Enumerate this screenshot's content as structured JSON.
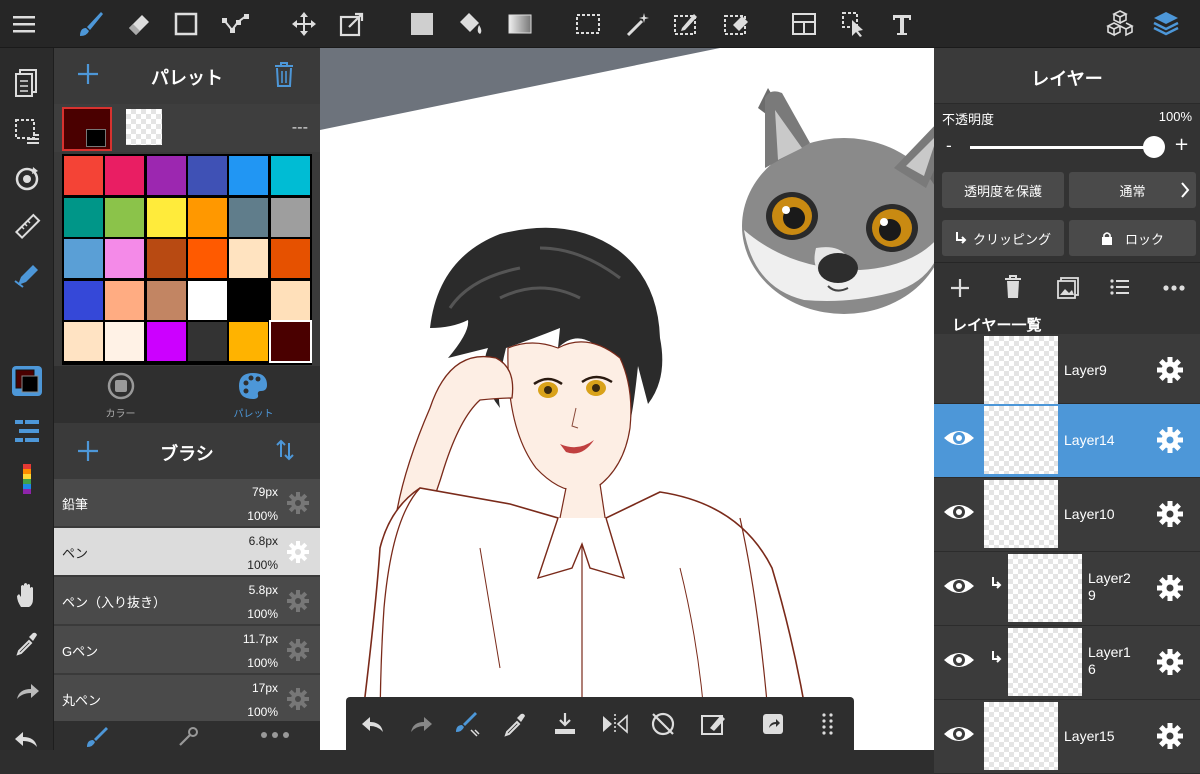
{
  "palette": {
    "title": "パレット",
    "right_text": "---",
    "current_color": "#4a0000",
    "tab_color_label": "カラー",
    "tab_palette_label": "パレット",
    "colors": [
      "#f44336",
      "#e91e63",
      "#9c27b0",
      "#3f51b5",
      "#2196f3",
      "#00bcd4",
      "#009688",
      "#8bc34a",
      "#ffeb3b",
      "#ff9800",
      "#607d8b",
      "#9e9e9e",
      "#5a9fd6",
      "#f48ae8",
      "#b84a12",
      "#ff5a00",
      "#ffe3c0",
      "#e65100",
      "#3548d8",
      "#ffac82",
      "#c28563",
      "#ffffff",
      "#000000",
      "#ffe0ba",
      "#ffe3c3",
      "#fff2e6",
      "#cc00ff",
      "#333333",
      "#ffb300",
      "#4a0000"
    ]
  },
  "brush": {
    "title": "ブラシ",
    "items": [
      {
        "name": "鉛筆",
        "size": "79px",
        "opacity": "100%"
      },
      {
        "name": "ペン",
        "size": "6.8px",
        "opacity": "100%"
      },
      {
        "name": "ペン（入り抜き）",
        "size": "5.8px",
        "opacity": "100%"
      },
      {
        "name": "Gペン",
        "size": "11.7px",
        "opacity": "100%"
      },
      {
        "name": "丸ペン",
        "size": "17px",
        "opacity": "100%"
      }
    ]
  },
  "layers": {
    "title": "レイヤー",
    "opacity_label": "不透明度",
    "opacity_value": "100%",
    "opacity_level": 1.0,
    "minus": "-",
    "plus": "+",
    "protect_label": "透明度を保護",
    "blend_label": "通常",
    "clipping_label": "クリッピング",
    "lock_label": "ロック",
    "list_title": "レイヤー一覧",
    "items": [
      {
        "name": "Layer9",
        "visible": false,
        "clipped": false
      },
      {
        "name": "Layer14",
        "visible": true,
        "clipped": false
      },
      {
        "name": "Layer10",
        "visible": true,
        "clipped": false
      },
      {
        "name": "Layer2\n9",
        "visible": true,
        "clipped": true
      },
      {
        "name": "Layer1\n6",
        "visible": true,
        "clipped": true
      },
      {
        "name": "Layer15",
        "visible": true,
        "clipped": false
      }
    ]
  },
  "colors": {
    "accent": "#4d97d8",
    "panel": "#3a3a3a",
    "topbar": "#262626"
  }
}
